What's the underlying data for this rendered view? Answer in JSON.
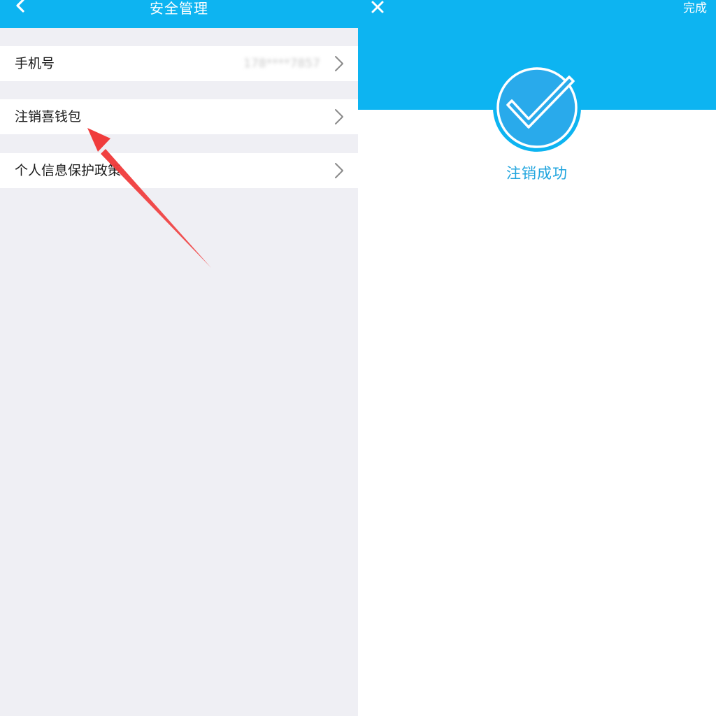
{
  "left_panel": {
    "header": {
      "title": "安全管理",
      "back_icon": "chevron-left-icon"
    },
    "rows": [
      {
        "label": "手机号",
        "value": "178****7857",
        "icon": "chevron-right-icon"
      },
      {
        "label": "注销喜钱包",
        "icon": "chevron-right-icon"
      },
      {
        "label": "个人信息保护政策",
        "icon": "chevron-right-icon"
      }
    ]
  },
  "right_panel": {
    "header": {
      "close_icon": "close-icon",
      "done_label": "完成"
    },
    "success_icon": "check-circle-icon",
    "success_text": "注销成功"
  },
  "colors": {
    "brand_blue": "#0db4f1",
    "success_text": "#1fa4de",
    "page_bg": "#efeff4",
    "annotation_red": "#f03c3c"
  }
}
